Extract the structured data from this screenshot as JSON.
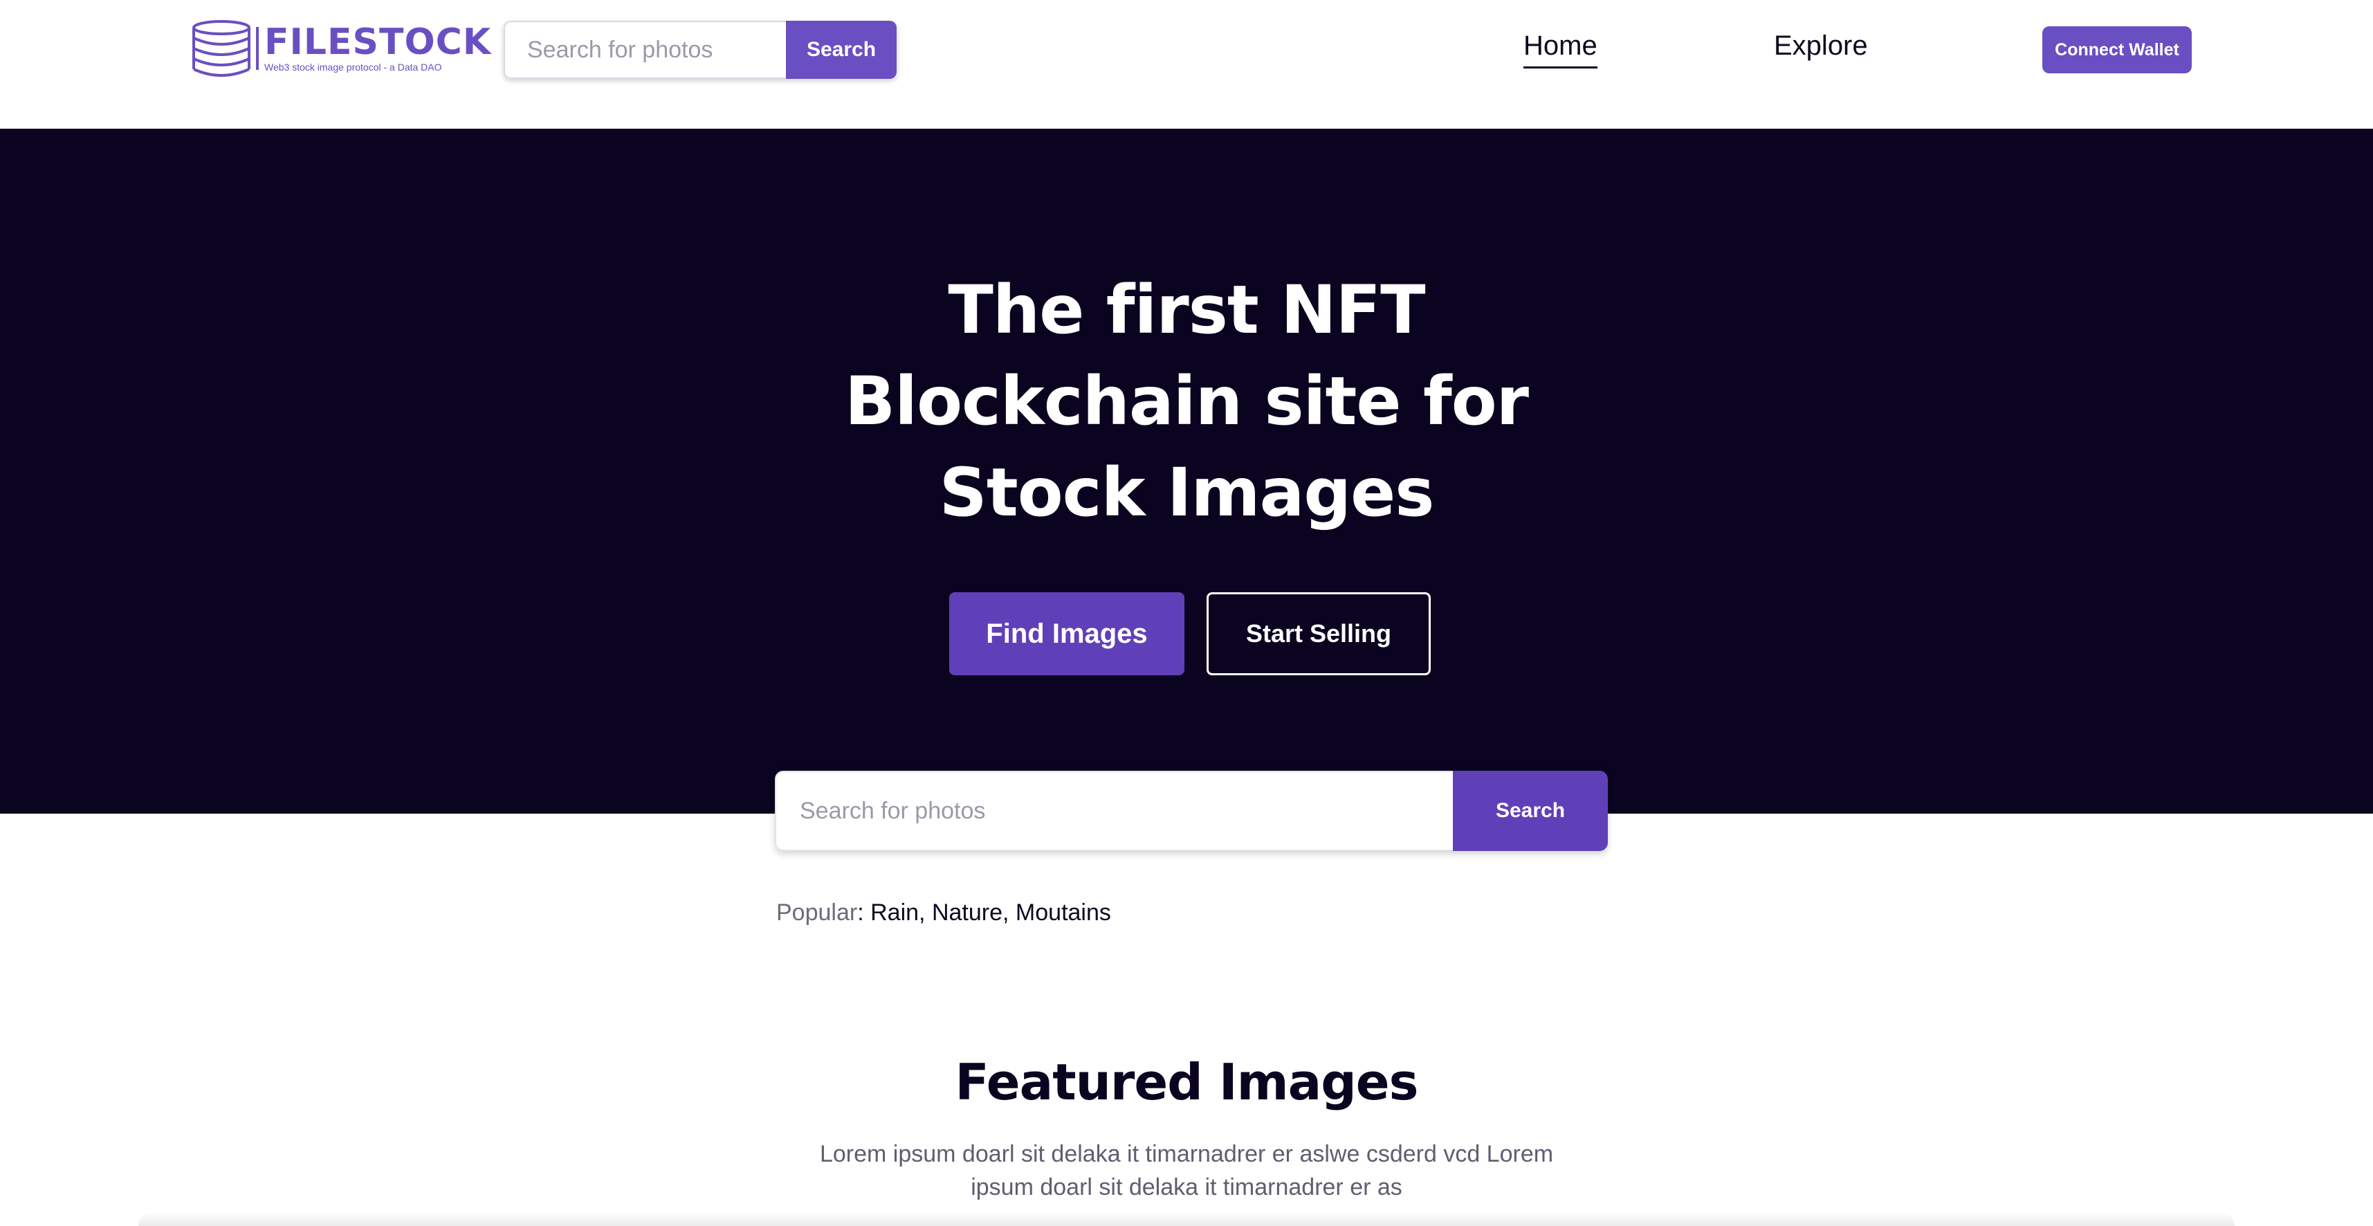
{
  "header": {
    "logo": {
      "title": "FILESTOCK",
      "subtitle": "Web3 stock image protocol - a Data DAO",
      "icon": "database-icon"
    },
    "search": {
      "placeholder": "Search for photos",
      "value": "",
      "button_label": "Search"
    },
    "nav": {
      "home": "Home",
      "explore": "Explore"
    },
    "connect_wallet_label": "Connect Wallet"
  },
  "hero": {
    "title": "The first NFT Blockchain site for Stock Images",
    "find_images_label": "Find Images",
    "start_selling_label": "Start Selling"
  },
  "main_search": {
    "placeholder": "Search for photos",
    "value": "",
    "button_label": "Search"
  },
  "popular": {
    "label": "Popular",
    "separator": ": ",
    "items": [
      "Rain",
      "Nature",
      "Moutains"
    ]
  },
  "featured": {
    "title": "Featured Images",
    "description": "Lorem ipsum doarl sit delaka it timarnadrer er aslwe csderd vcd Lorem ipsum doarl sit delaka it timarnadrer er as"
  },
  "colors": {
    "brand_purple": "#6a4fc2",
    "button_purple": "#6040b8",
    "hero_background": "#0b0420",
    "text_dark": "#0c0a1f"
  }
}
